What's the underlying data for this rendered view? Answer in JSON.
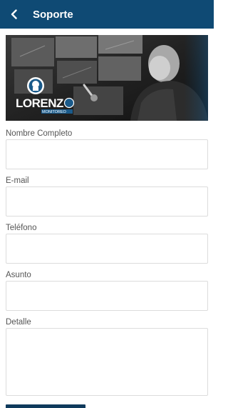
{
  "app_bar": {
    "title": "Soporte",
    "back_icon": "chevron-left-icon"
  },
  "banner": {
    "logo_text": "LORENZO",
    "logo_subtext": "MONITOREO"
  },
  "form": {
    "fields": [
      {
        "label": "Nombre Completo",
        "value": "",
        "placeholder": ""
      },
      {
        "label": "E-mail",
        "value": "",
        "placeholder": ""
      },
      {
        "label": "Teléfono",
        "value": "",
        "placeholder": ""
      },
      {
        "label": "Asunto",
        "value": "",
        "placeholder": ""
      },
      {
        "label": "Detalle",
        "value": "",
        "placeholder": ""
      }
    ]
  },
  "colors": {
    "primary": "#0f4a74",
    "button": "#0f3a5c",
    "border": "#dcdcdc"
  }
}
